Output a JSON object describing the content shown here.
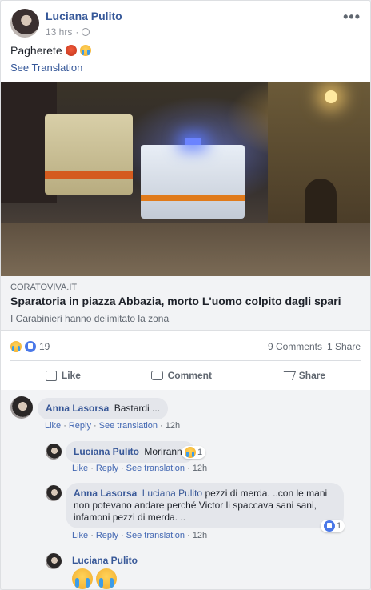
{
  "post": {
    "author": "Luciana Pulito",
    "time": "13 hrs",
    "text": "Pagherete",
    "see_translation": "See Translation",
    "more_label": "•••"
  },
  "link": {
    "domain": "CORATOVIVA.IT",
    "title": "Sparatoria in piazza Abbazia, morto L'uomo colpito dagli spari",
    "description": "I Carabinieri hanno delimitato la zona"
  },
  "stats": {
    "reaction_count": "19",
    "comments": "9 Comments",
    "shares": "1 Share"
  },
  "actions": {
    "like": "Like",
    "comment": "Comment",
    "share": "Share"
  },
  "comment_actions": {
    "like": "Like",
    "reply": "Reply",
    "see_translation": "See translation",
    "separator": "·"
  },
  "comments": [
    {
      "author": "Anna Lasorsa",
      "text": "Bastardi ...",
      "time": "12h"
    },
    {
      "author": "Luciana Pulito",
      "text": "Moriranno",
      "time": "12h",
      "reaction_count": "1"
    },
    {
      "author": "Anna Lasorsa",
      "mention": "Luciana Pulito",
      "text": "pezzi di merda. ..con le mani non potevano andare perché Victor li spaccava sani sani, infamoni pezzi di merda. ..",
      "time": "12h",
      "reaction_count": "1"
    },
    {
      "author": "Luciana Pulito"
    }
  ]
}
